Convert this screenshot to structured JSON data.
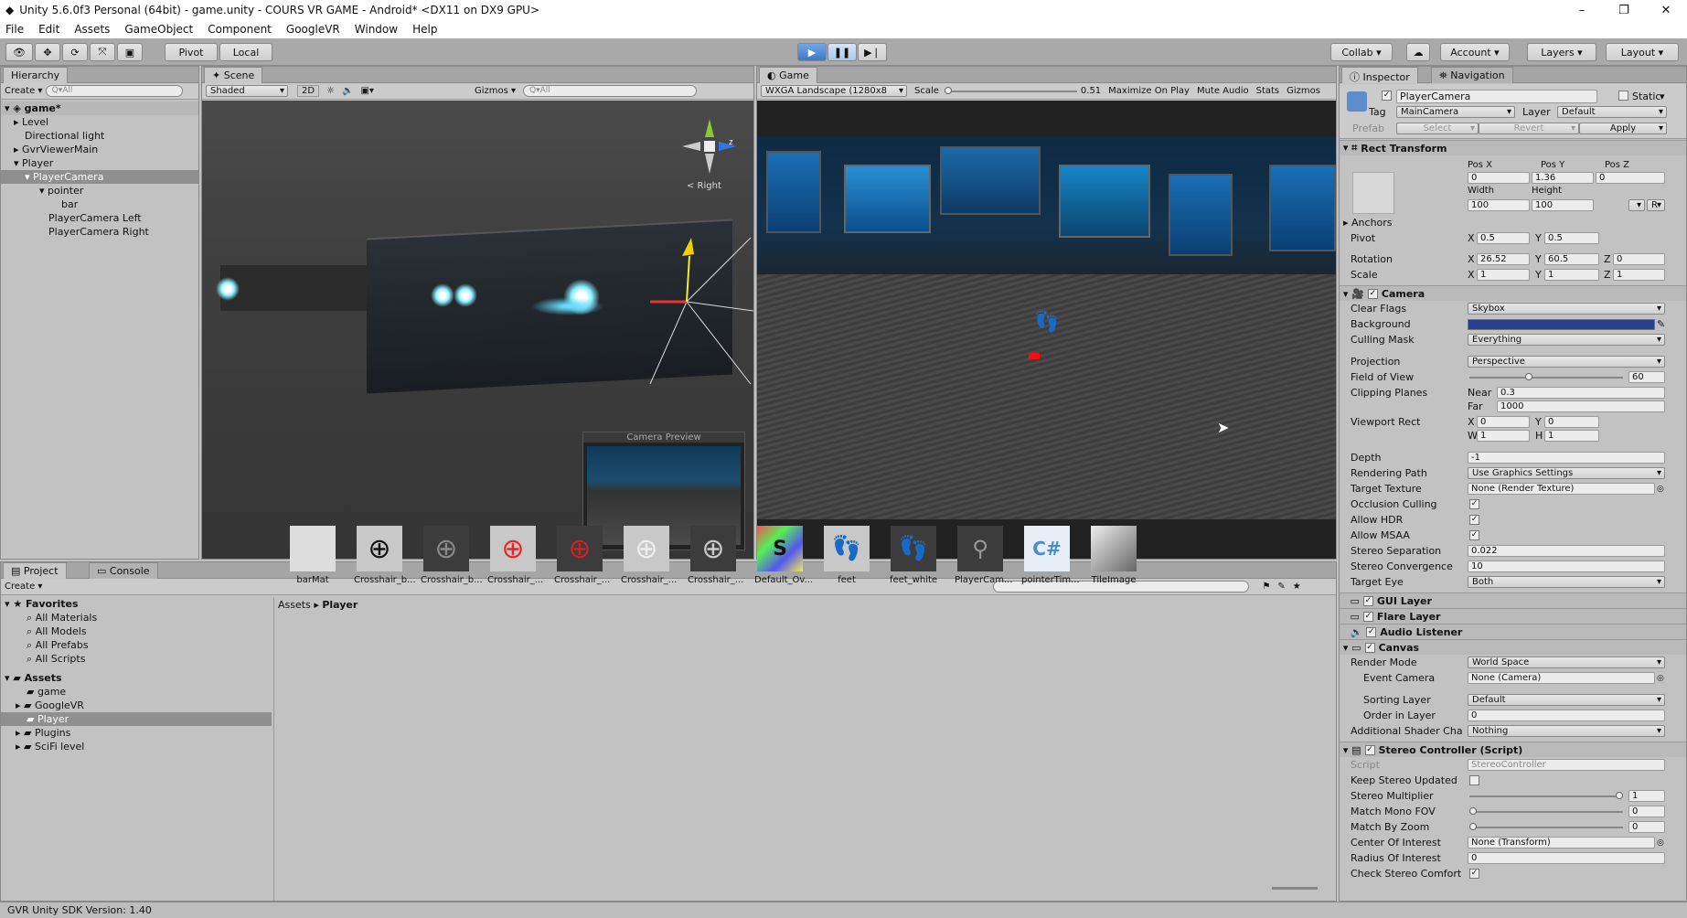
{
  "window": {
    "title": "Unity 5.6.0f3 Personal (64bit) - game.unity - COURS VR GAME - Android* <DX11 on DX9 GPU>",
    "min": "–",
    "max": "❐",
    "close": "✕"
  },
  "menu": [
    "File",
    "Edit",
    "Assets",
    "GameObject",
    "Component",
    "GoogleVR",
    "Window",
    "Help"
  ],
  "toolbar": {
    "pivot": "Pivot",
    "local": "Local",
    "collab": "Collab",
    "account": "Account",
    "layers": "Layers",
    "layout": "Layout"
  },
  "hierarchy": {
    "tab": "Hierarchy",
    "create": "Create",
    "search": "Q▾All",
    "scene": "game*",
    "items": [
      "Level",
      "Directional light",
      "GvrViewerMain",
      "Player",
      "PlayerCamera",
      "pointer",
      "bar",
      "PlayerCamera Left",
      "PlayerCamera Right"
    ]
  },
  "scene": {
    "tab": "Scene",
    "shading": "Shaded",
    "mode2d": "2D",
    "gizmos": "Gizmos",
    "search": "Q▾All",
    "gizmo_label": "< Right",
    "preview_label": "Camera Preview"
  },
  "game": {
    "tab": "Game",
    "resolution": "WXGA Landscape (1280x8",
    "scale_label": "Scale",
    "scale_value": "0.51",
    "maximize": "Maximize On Play",
    "mute": "Mute Audio",
    "stats": "Stats",
    "gizmos": "Gizmos"
  },
  "inspector": {
    "tab": "Inspector",
    "nav_tab": "Navigation",
    "object_name": "PlayerCamera",
    "static": "Static",
    "tag_label": "Tag",
    "tag": "MainCamera",
    "layer_label": "Layer",
    "layer": "Default",
    "prefab": "Prefab",
    "select": "Select",
    "revert": "Revert",
    "apply": "Apply",
    "rect": {
      "title": "Rect Transform",
      "posx_l": "Pos X",
      "posy_l": "Pos Y",
      "posz_l": "Pos Z",
      "posx": "0",
      "posy": "1.36",
      "posz": "0",
      "width_l": "Width",
      "height_l": "Height",
      "width": "100",
      "height": "100",
      "anchors": "Anchors",
      "pivot": "Pivot",
      "pivot_x": "0.5",
      "pivot_y": "0.5",
      "rotation": "Rotation",
      "rot_x": "26.52",
      "rot_y": "60.5",
      "rot_z": "0",
      "scale": "Scale",
      "sc_x": "1",
      "sc_y": "1",
      "sc_z": "1",
      "x": "X",
      "y": "Y",
      "z": "Z",
      "w": "W",
      "h": "H",
      "r": "R"
    },
    "camera": {
      "title": "Camera",
      "clear_flags_l": "Clear Flags",
      "clear_flags": "Skybox",
      "background_l": "Background",
      "background_color": "#2a3f8c",
      "culling_l": "Culling Mask",
      "culling": "Everything",
      "projection_l": "Projection",
      "projection": "Perspective",
      "fov_l": "Field of View",
      "fov": "60",
      "fov_fraction": 0.38,
      "clip_l": "Clipping Planes",
      "near_l": "Near",
      "near": "0.3",
      "far_l": "Far",
      "far": "1000",
      "vp_l": "Viewport Rect",
      "vp_x": "0",
      "vp_y": "0",
      "vp_w": "1",
      "vp_h": "1",
      "depth_l": "Depth",
      "depth": "-1",
      "rpath_l": "Rendering Path",
      "rpath": "Use Graphics Settings",
      "tt_l": "Target Texture",
      "tt": "None (Render Texture)",
      "occ_l": "Occlusion Culling",
      "hdr_l": "Allow HDR",
      "msaa_l": "Allow MSAA",
      "ss_l": "Stereo Separation",
      "ss": "0.022",
      "sc_l": "Stereo Convergence",
      "sc": "10",
      "te_l": "Target Eye",
      "te": "Both",
      "check": "✓"
    },
    "components": {
      "gui": "GUI Layer",
      "flare": "Flare Layer",
      "audio": "Audio Listener",
      "canvas": "Canvas"
    },
    "canvas": {
      "rm_l": "Render Mode",
      "rm": "World Space",
      "ec_l": "Event Camera",
      "ec": "None (Camera)",
      "sl_l": "Sorting Layer",
      "sl": "Default",
      "oil_l": "Order in Layer",
      "oil": "0",
      "asc_l": "Additional Shader Cha",
      "asc": "Nothing"
    },
    "stereo": {
      "title": "Stereo Controller (Script)",
      "script_l": "Script",
      "script": "StereoController",
      "ksu_l": "Keep Stereo Updated",
      "sm_l": "Stereo Multiplier",
      "sm": "1",
      "sm_fraction": 1.0,
      "mmf_l": "Match Mono FOV",
      "mmf": "0",
      "mmf_fraction": 0.0,
      "mbz_l": "Match By Zoom",
      "mbz": "0",
      "mbz_fraction": 0.0,
      "coi_l": "Center Of Interest",
      "coi": "None (Transform)",
      "roi_l": "Radius Of Interest",
      "roi": "0",
      "csc_l": "Check Stereo Comfort"
    }
  },
  "project": {
    "tab": "Project",
    "console_tab": "Console",
    "create": "Create",
    "breadcrumb_root": "Assets",
    "breadcrumb_sep": "▸",
    "breadcrumb_current": "Player",
    "favorites": "Favorites",
    "fav_items": [
      "All Materials",
      "All Models",
      "All Prefabs",
      "All Scripts"
    ],
    "assets": "Assets",
    "asset_folders": [
      "game",
      "GoogleVR",
      "Player",
      "Plugins",
      "SciFi level"
    ],
    "files": [
      "barMat",
      "Crosshair_b...",
      "Crosshair_b...",
      "Crosshair_...",
      "Crosshair_...",
      "Crosshair_...",
      "Crosshair_...",
      "Default_Ov...",
      "feet",
      "feet_white",
      "PlayerCam...",
      "pointerTim...",
      "TileImage"
    ]
  },
  "status": "GVR Unity SDK Version: 1.40"
}
